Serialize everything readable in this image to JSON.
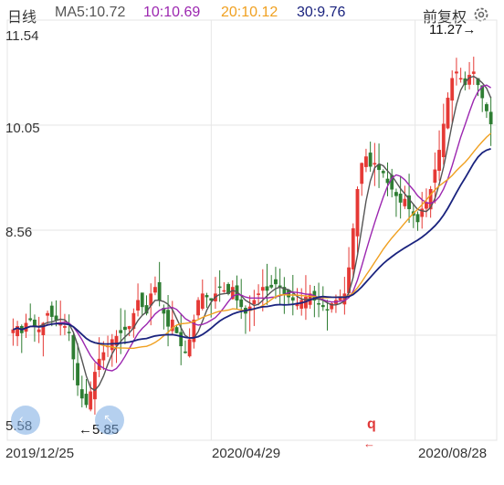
{
  "legend": {
    "period": "日线",
    "ma5": "MA5:10.72",
    "ma10": "10:10.69",
    "ma20": "20:10.12",
    "ma30": "30:9.76",
    "adjust": "前复权",
    "settings_icon": "gear-icon"
  },
  "annotations": {
    "high": "11.27→",
    "low": "←5.85",
    "marker": "q",
    "marker_line": "←"
  },
  "colors": {
    "up": "#e53935",
    "down": "#2e7d32",
    "ma5": "#555555",
    "ma10": "#9c27b0",
    "ma20": "#f0a020",
    "ma30": "#1a237e",
    "grid": "#e6e6e6"
  },
  "chart_data": {
    "type": "candlestick",
    "title": "",
    "y_ticks": [
      "11.54",
      "10.05",
      "8.56",
      "5.58"
    ],
    "x_ticks": [
      "2019/12/25",
      "2020/04/29",
      "2020/08/28"
    ],
    "ylim": [
      5.58,
      11.54
    ],
    "high_label": 11.27,
    "low_label": 5.85,
    "series": [
      {
        "name": "MA5",
        "value": 10.72
      },
      {
        "name": "MA10",
        "value": 10.69
      },
      {
        "name": "MA20",
        "value": 10.12
      },
      {
        "name": "MA30",
        "value": 9.76
      }
    ],
    "close": [
      7.05,
      7.1,
      7.0,
      7.15,
      7.2,
      7.1,
      7.05,
      7.15,
      7.3,
      7.25,
      7.2,
      7.15,
      7.1,
      7.0,
      6.6,
      6.2,
      6.0,
      5.9,
      6.1,
      6.4,
      6.6,
      6.7,
      6.8,
      6.9,
      6.95,
      7.0,
      7.05,
      7.1,
      7.3,
      7.5,
      7.4,
      7.3,
      7.6,
      7.7,
      7.5,
      7.3,
      7.1,
      7.2,
      7.0,
      6.8,
      6.7,
      6.9,
      7.2,
      7.5,
      7.6,
      7.55,
      7.5,
      7.6,
      7.7,
      7.65,
      7.6,
      7.7,
      7.5,
      7.4,
      7.3,
      7.4,
      7.5,
      7.6,
      7.7,
      7.65,
      7.7,
      7.75,
      7.7,
      7.6,
      7.55,
      7.5,
      7.45,
      7.5,
      7.55,
      7.6,
      7.5,
      7.45,
      7.4,
      7.35,
      7.45,
      7.5,
      7.55,
      7.6,
      8.0,
      8.6,
      9.2,
      9.6,
      9.7,
      9.55,
      9.6,
      9.5,
      9.45,
      9.3,
      9.2,
      9.1,
      9.0,
      9.05,
      8.9,
      8.8,
      8.7,
      8.9,
      9.0,
      9.2,
      9.5,
      9.8,
      10.2,
      10.6,
      10.9,
      11.0,
      10.9,
      10.8,
      10.95,
      11.0,
      10.8,
      10.6,
      10.4,
      10.2
    ],
    "ma_unit": "price"
  }
}
